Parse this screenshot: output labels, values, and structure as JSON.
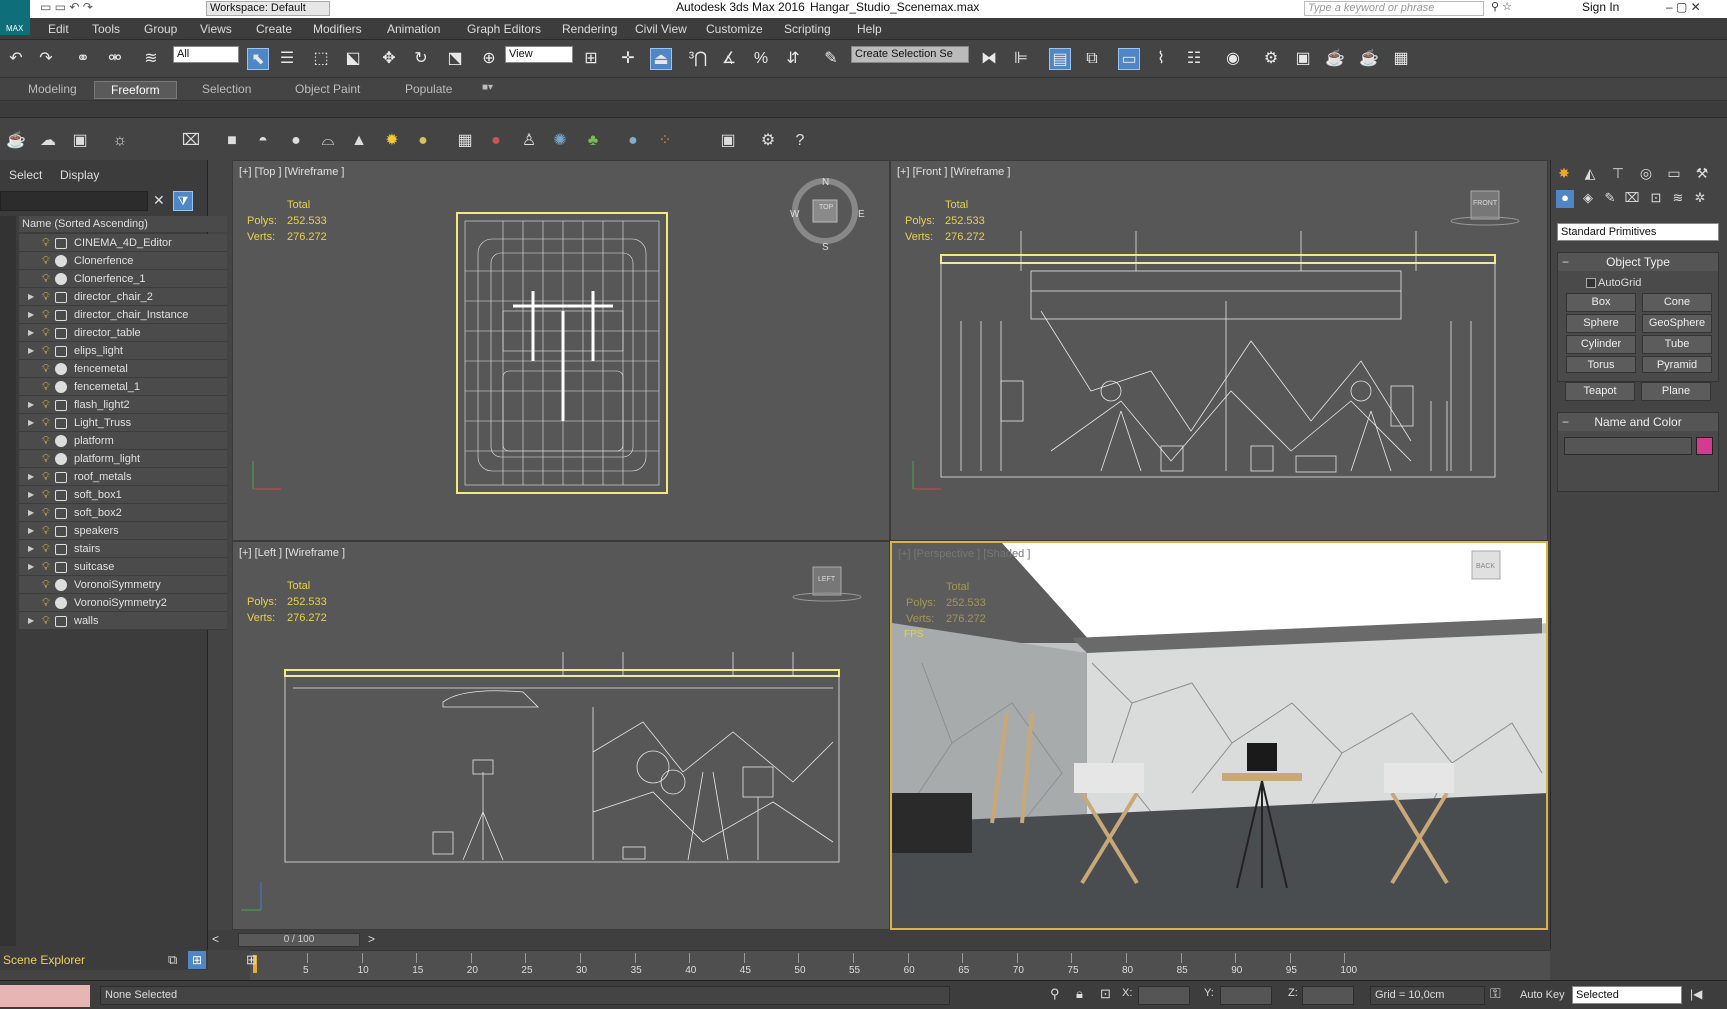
{
  "title": {
    "app": "Autodesk 3ds Max 2016",
    "file": "Hangar_Studio_Scenemax.max",
    "workspace": "Workspace: Default",
    "search_placeholder": "Type a keyword or phrase",
    "sign_in": "Sign In",
    "logo": "MAX"
  },
  "menu": [
    "Edit",
    "Tools",
    "Group",
    "Views",
    "Create",
    "Modifiers",
    "Animation",
    "Graph Editors",
    "Rendering",
    "Civil View",
    "Customize",
    "Scripting",
    "Help"
  ],
  "toolbar": {
    "filter": "All",
    "view": "View",
    "selection_set": "Create Selection Se"
  },
  "ribbon_tabs": [
    {
      "label": "Modeling",
      "active": false
    },
    {
      "label": "Freeform",
      "active": true
    },
    {
      "label": "Selection",
      "active": false
    },
    {
      "label": "Object Paint",
      "active": false
    },
    {
      "label": "Populate",
      "active": false
    }
  ],
  "explorer": {
    "tab_select": "Select",
    "tab_display": "Display",
    "column_header": "Name (Sorted Ascending)",
    "footer": "Scene Explorer",
    "objects": [
      {
        "name": "CINEMA_4D_Editor",
        "expand": false,
        "icon": "box"
      },
      {
        "name": "Clonerfence",
        "expand": false,
        "icon": "sphere"
      },
      {
        "name": "Clonerfence_1",
        "expand": false,
        "icon": "sphere"
      },
      {
        "name": "director_chair_2",
        "expand": true,
        "icon": "box"
      },
      {
        "name": "director_chair_Instance",
        "expand": true,
        "icon": "box"
      },
      {
        "name": "director_table",
        "expand": true,
        "icon": "box"
      },
      {
        "name": "elips_light",
        "expand": true,
        "icon": "box"
      },
      {
        "name": "fencemetal",
        "expand": false,
        "icon": "sphere"
      },
      {
        "name": "fencemetal_1",
        "expand": false,
        "icon": "sphere"
      },
      {
        "name": "flash_light2",
        "expand": true,
        "icon": "box"
      },
      {
        "name": "Light_Truss",
        "expand": true,
        "icon": "box"
      },
      {
        "name": "platform",
        "expand": false,
        "icon": "sphere"
      },
      {
        "name": "platform_light",
        "expand": false,
        "icon": "sphere"
      },
      {
        "name": "roof_metals",
        "expand": true,
        "icon": "box"
      },
      {
        "name": "soft_box1",
        "expand": true,
        "icon": "box"
      },
      {
        "name": "soft_box2",
        "expand": true,
        "icon": "box"
      },
      {
        "name": "speakers",
        "expand": true,
        "icon": "box"
      },
      {
        "name": "stairs",
        "expand": true,
        "icon": "box"
      },
      {
        "name": "suitcase",
        "expand": true,
        "icon": "box"
      },
      {
        "name": "VoronoiSymmetry",
        "expand": false,
        "icon": "sphere"
      },
      {
        "name": "VoronoiSymmetry2",
        "expand": false,
        "icon": "sphere"
      },
      {
        "name": "walls",
        "expand": true,
        "icon": "box"
      }
    ]
  },
  "viewports": {
    "top": {
      "label": "[+] [Top ] [Wireframe ]",
      "navcube": "TOP",
      "compass": {
        "n": "N",
        "s": "S",
        "e": "E",
        "w": "W"
      }
    },
    "front": {
      "label": "[+] [Front ] [Wireframe ]",
      "navcube": "FRONT"
    },
    "left": {
      "label": "[+] [Left ] [Wireframe ]",
      "navcube": "LEFT"
    },
    "perspective": {
      "label": "[+] [Perspective ] [Shaded ]",
      "navcube": "BACK",
      "fps": "FPS"
    },
    "stats": {
      "total": "Total",
      "polys_label": "Polys:",
      "polys": "252.533",
      "verts_label": "Verts:",
      "verts": "276.272"
    }
  },
  "command_panel": {
    "category": "Standard Primitives",
    "object_type": "Object Type",
    "autogrid": "AutoGrid",
    "buttons": [
      "Box",
      "Cone",
      "Sphere",
      "GeoSphere",
      "Cylinder",
      "Tube",
      "Torus",
      "Pyramid",
      "Teapot",
      "Plane"
    ],
    "name_color": "Name and Color",
    "color": "#d43a8e"
  },
  "timeline": {
    "frame": "0 / 100",
    "ticks": [
      "5",
      "10",
      "15",
      "20",
      "25",
      "30",
      "35",
      "40",
      "45",
      "50",
      "55",
      "60",
      "65",
      "70",
      "75",
      "80",
      "85",
      "90",
      "95",
      "100"
    ]
  },
  "status": {
    "text": "None Selected",
    "x": "X:",
    "y": "Y:",
    "z": "Z:",
    "grid": "Grid = 10,0cm",
    "auto_key": "Auto Key",
    "key_mode": "Selected"
  }
}
